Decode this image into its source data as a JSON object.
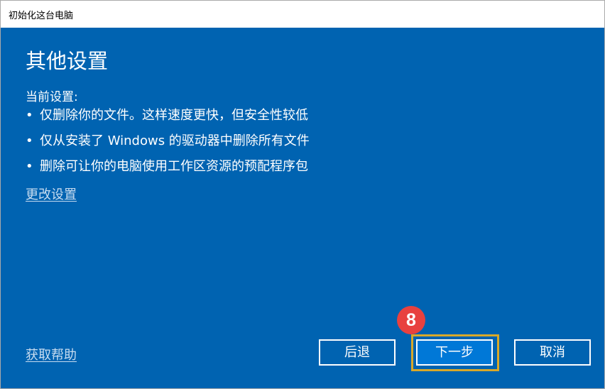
{
  "window": {
    "title": "初始化这台电脑"
  },
  "main": {
    "heading": "其他设置",
    "current_label": "当前设置:",
    "bullet_symbol": "•",
    "bullets": [
      "仅删除你的文件。这样速度更快，但安全性较低",
      "仅从安装了 Windows 的驱动器中删除所有文件",
      "删除可让你的电脑使用工作区资源的预配程序包"
    ],
    "change_settings_link": "更改设置"
  },
  "footer": {
    "help_link": "获取帮助",
    "back_label": "后退",
    "next_label": "下一步",
    "cancel_label": "取消"
  },
  "annotation": {
    "step_number": "8",
    "badge_color": "#e8413f",
    "highlight_color": "#d8a82a"
  },
  "colors": {
    "content_background": "#0063b1",
    "next_button_background": "#0078d7",
    "text": "#ffffff"
  }
}
